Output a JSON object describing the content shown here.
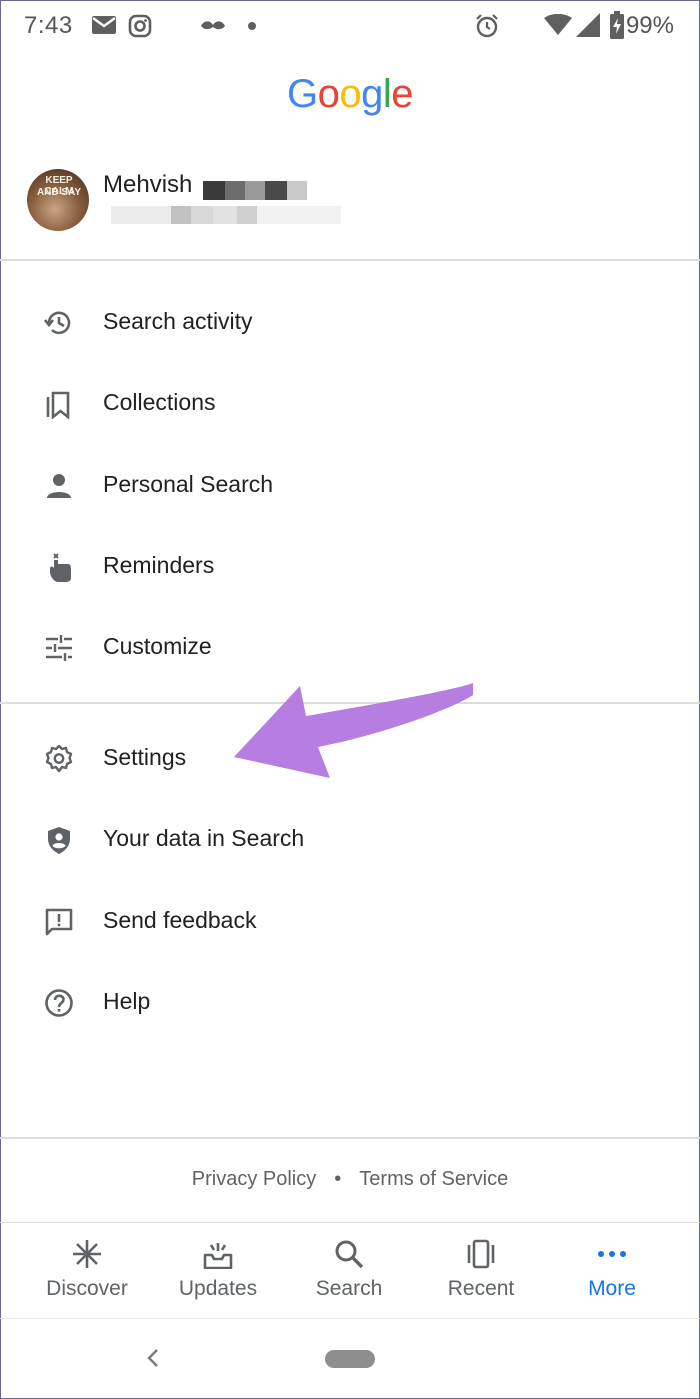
{
  "status_bar": {
    "time": "7:43",
    "battery_percent": "99%",
    "icons": [
      "gmail-icon",
      "instagram-icon",
      "mustache-icon",
      "dot-icon",
      "alarm-icon",
      "wifi-icon",
      "signal-icon",
      "battery-charging-icon"
    ]
  },
  "header": {
    "logo_letters": [
      "G",
      "o",
      "o",
      "g",
      "l",
      "e"
    ],
    "logo_colors": [
      "#4285F4",
      "#EA4335",
      "#FBBC05",
      "#4285F4",
      "#34A853",
      "#EA4335"
    ]
  },
  "account": {
    "name": "Mehvish",
    "avatar_text": [
      "KEEP CALM",
      "AND SAY"
    ]
  },
  "menu_group_1": [
    {
      "label": "Search activity",
      "icon": "history-icon"
    },
    {
      "label": "Collections",
      "icon": "bookmarks-icon"
    },
    {
      "label": "Personal Search",
      "icon": "person-icon"
    },
    {
      "label": "Reminders",
      "icon": "reminder-finger-icon"
    },
    {
      "label": "Customize",
      "icon": "sliders-icon"
    }
  ],
  "menu_group_2": [
    {
      "label": "Settings",
      "icon": "gear-icon"
    },
    {
      "label": "Your data in Search",
      "icon": "shield-person-icon"
    },
    {
      "label": "Send feedback",
      "icon": "feedback-icon"
    },
    {
      "label": "Help",
      "icon": "help-icon"
    }
  ],
  "footer": {
    "privacy": "Privacy Policy",
    "separator": "•",
    "terms": "Terms of Service"
  },
  "bottom_nav": [
    {
      "label": "Discover",
      "icon": "asterisk-icon",
      "active": false
    },
    {
      "label": "Updates",
      "icon": "updates-tray-icon",
      "active": false
    },
    {
      "label": "Search",
      "icon": "search-icon",
      "active": false
    },
    {
      "label": "Recent",
      "icon": "recent-cards-icon",
      "active": false
    },
    {
      "label": "More",
      "icon": "more-dots-icon",
      "active": true
    }
  ],
  "colors": {
    "accent": "#1a73e8",
    "annotation_arrow": "#b57ee0",
    "divider": "#dadce0"
  }
}
